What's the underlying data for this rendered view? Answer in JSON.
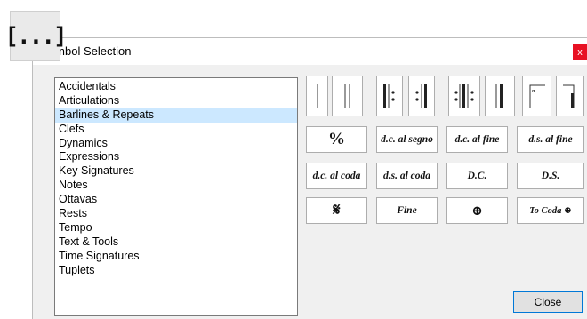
{
  "app_icon": {
    "glyph": "[...]"
  },
  "dialog": {
    "title": "Symbol Selection",
    "close_x": "x",
    "close_button_label": "Close"
  },
  "categories": [
    "Accidentals",
    "Articulations",
    "Barlines & Repeats",
    "Clefs",
    "Dynamics",
    "Expressions",
    "Key Signatures",
    "Notes",
    "Ottavas",
    "Rests",
    "Tempo",
    "Text & Tools",
    "Time Signatures",
    "Tuplets"
  ],
  "selected_category": "Barlines & Repeats",
  "symbols": {
    "row1": [
      "single-barline",
      "double-barline",
      "start-repeat",
      "end-repeat",
      "end-start-repeat",
      "final-barline",
      "first-ending",
      "second-ending"
    ],
    "row2": [
      "%",
      "d.c. al segno",
      "d.c. al fine",
      "d.s. al fine"
    ],
    "row3": [
      "d.c. al coda",
      "d.s. al coda",
      "D.C.",
      "D.S."
    ],
    "row4": [
      "𝄋",
      "Fine",
      "⊕",
      "To Coda ⊕"
    ]
  },
  "colors": {
    "selection": "#cce8ff",
    "close_x_bg": "#e81123",
    "accent_border": "#0078d7"
  }
}
